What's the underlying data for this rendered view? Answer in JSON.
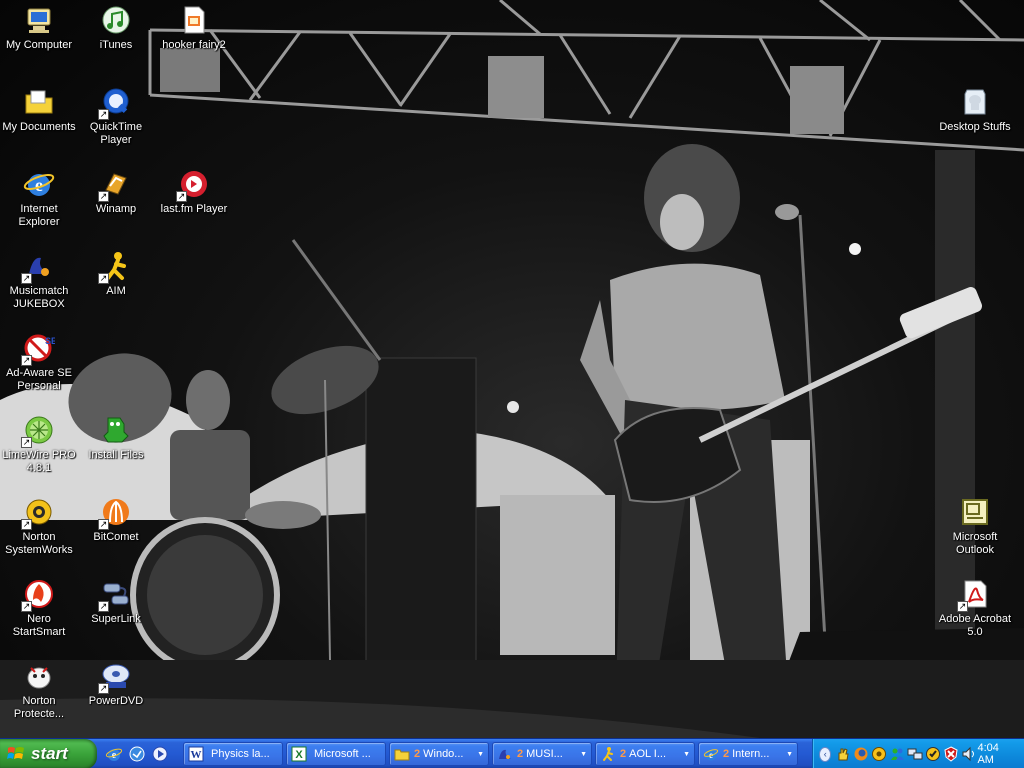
{
  "desktop": {
    "icons": [
      {
        "id": "my-computer",
        "label": "My Computer",
        "icon": "computer-icon",
        "shortcut": false
      },
      {
        "id": "itunes",
        "label": "iTunes",
        "icon": "itunes-icon",
        "shortcut": false
      },
      {
        "id": "hooker-fairy2",
        "label": "hooker fairy2",
        "icon": "document-icon",
        "shortcut": false
      },
      {
        "id": "my-documents",
        "label": "My Documents",
        "icon": "folder-icon",
        "shortcut": false
      },
      {
        "id": "quicktime",
        "label": "QuickTime\nPlayer",
        "icon": "quicktime-icon",
        "shortcut": true
      },
      {
        "id": "desktop-stuffs",
        "label": "Desktop Stuffs",
        "icon": "folder-icon",
        "shortcut": false
      },
      {
        "id": "internet-explorer",
        "label": "Internet\nExplorer",
        "icon": "ie-icon",
        "shortcut": false
      },
      {
        "id": "winamp",
        "label": "Winamp",
        "icon": "winamp-icon",
        "shortcut": true
      },
      {
        "id": "lastfm",
        "label": "last.fm Player",
        "icon": "lastfm-icon",
        "shortcut": true
      },
      {
        "id": "musicmatch",
        "label": "Musicmatch\nJUKEBOX",
        "icon": "musicmatch-icon",
        "shortcut": true
      },
      {
        "id": "aim",
        "label": "AIM",
        "icon": "aim-icon",
        "shortcut": true
      },
      {
        "id": "adaware",
        "label": "Ad-Aware SE\nPersonal",
        "icon": "adaware-icon",
        "shortcut": true
      },
      {
        "id": "limewire",
        "label": "LimeWire PRO\n4.8.1",
        "icon": "limewire-icon",
        "shortcut": true
      },
      {
        "id": "install-files",
        "label": "Install Files",
        "icon": "folder-icon",
        "shortcut": false
      },
      {
        "id": "norton-systemworks",
        "label": "Norton\nSystemWorks",
        "icon": "norton-icon",
        "shortcut": true
      },
      {
        "id": "bitcomet",
        "label": "BitComet",
        "icon": "bitcomet-icon",
        "shortcut": true
      },
      {
        "id": "microsoft-outlook",
        "label": "Microsoft\nOutlook",
        "icon": "outlook-icon",
        "shortcut": false
      },
      {
        "id": "nero",
        "label": "Nero\nStartSmart",
        "icon": "nero-icon",
        "shortcut": true
      },
      {
        "id": "superlink",
        "label": "SuperLink",
        "icon": "superlink-icon",
        "shortcut": true
      },
      {
        "id": "adobe-acrobat",
        "label": "Adobe Acrobat\n5.0",
        "icon": "acrobat-icon",
        "shortcut": true
      },
      {
        "id": "norton-protected",
        "label": "Norton\nProtecte...",
        "icon": "norton-protected-icon",
        "shortcut": false
      },
      {
        "id": "powerdvd",
        "label": "PowerDVD",
        "icon": "powerdvd-icon",
        "shortcut": true
      }
    ]
  },
  "taskbar": {
    "start_label": "start",
    "quick_launch": [
      "ie-icon",
      "outlook-express-icon",
      "media-player-icon"
    ],
    "buttons": [
      {
        "label": "Physics la...",
        "count": "",
        "icon": "word-icon",
        "active": false,
        "arrow": false
      },
      {
        "label": "Microsoft ...",
        "count": "",
        "icon": "excel-icon",
        "active": false,
        "arrow": false
      },
      {
        "label": "Windo...",
        "count": "2",
        "icon": "folder-icon",
        "active": false,
        "arrow": true
      },
      {
        "label": "MUSI...",
        "count": "2",
        "icon": "musicmatch-icon",
        "active": false,
        "arrow": true
      },
      {
        "label": "AOL I...",
        "count": "2",
        "icon": "aim-icon",
        "active": false,
        "arrow": true
      },
      {
        "label": "Intern...",
        "count": "2",
        "icon": "ie-icon",
        "active": false,
        "arrow": true
      }
    ],
    "tray_expand": "‹",
    "tray_icons": [
      "hand-icon",
      "firefox-icon",
      "speaker-icon",
      "msn-icon",
      "network-icon",
      "norton-tray-icon",
      "security-icon",
      "volume-icon"
    ],
    "clock": "4:04 AM"
  }
}
